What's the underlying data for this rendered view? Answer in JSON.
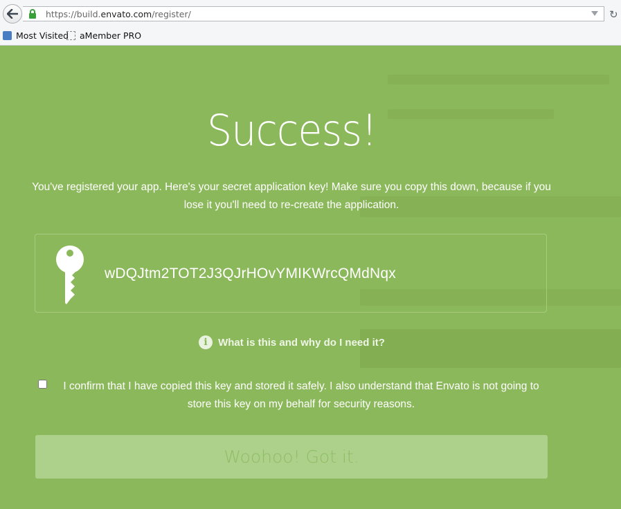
{
  "browser": {
    "url_prefix": "https://build.",
    "url_host": "envato.com",
    "url_path": "/register/",
    "bookmarks": [
      {
        "label": "Most Visited",
        "icon": "most-visited-icon"
      },
      {
        "label": "aMember PRO",
        "icon": "page-icon"
      }
    ]
  },
  "page": {
    "title": "Success!",
    "description": "You've registered your app. Here's your secret application key! Make sure you copy this down, because if you lose it you'll need to re-create the application.",
    "api_key": "wDQJtm2TOT2J3QJrHOvYMIKWrcQMdNqx",
    "info_link": "What is this and why do I need it?",
    "confirm_text": "I confirm that I have copied this key and stored it safely. I also understand that Envato is not going to store this key on my behalf for security reasons.",
    "confirm_checked": false,
    "submit_label": "Woohoo! Got it."
  },
  "colors": {
    "background": "#8bb85a",
    "button_bg": "#add08a",
    "button_text": "#8fbe67"
  }
}
